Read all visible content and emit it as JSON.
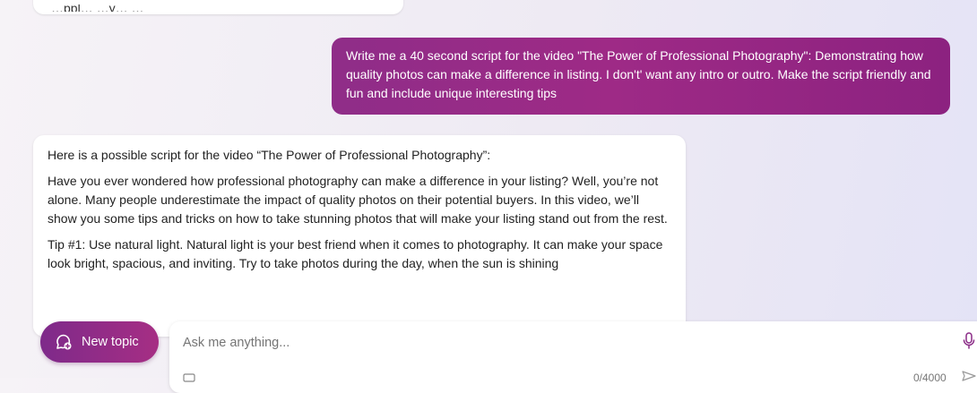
{
  "previous_message": {
    "visible_text": "…ppl…                         …y…                 …"
  },
  "user_message": {
    "text": "Write me a 40 second script for  the video \"The Power of Professional Photography\": Demonstrating how quality photos can make a difference in listing. I don't' want any intro or outro. Make the script friendly and fun and include  unique interesting tips"
  },
  "bot_message": {
    "paragraphs": [
      "Here is a possible script for the video “The Power of Professional Photography”:",
      "Have you ever wondered how professional photography can make a difference in your listing? Well, you’re not alone. Many people underestimate the impact of quality photos on their potential buyers. In this video, we’ll show you some tips and tricks on how to take stunning photos that will make your listing stand out from the rest.",
      "Tip #1: Use natural light. Natural light is your best friend when it comes to photography. It can make your space look bright, spacious, and inviting. Try to take photos during the day, when the sun is shining"
    ]
  },
  "new_topic_button": {
    "label": "New topic",
    "icon": "chat-plus-icon"
  },
  "composer": {
    "placeholder": "Ask me anything...",
    "char_counter": "0/4000",
    "icons": [
      "microphone-icon",
      "image-icon",
      "send-icon"
    ]
  },
  "colors": {
    "accent_gradient_start": "#8f2d88",
    "accent_gradient_end": "#a62e84",
    "bubble_bg": "#ffffff"
  }
}
